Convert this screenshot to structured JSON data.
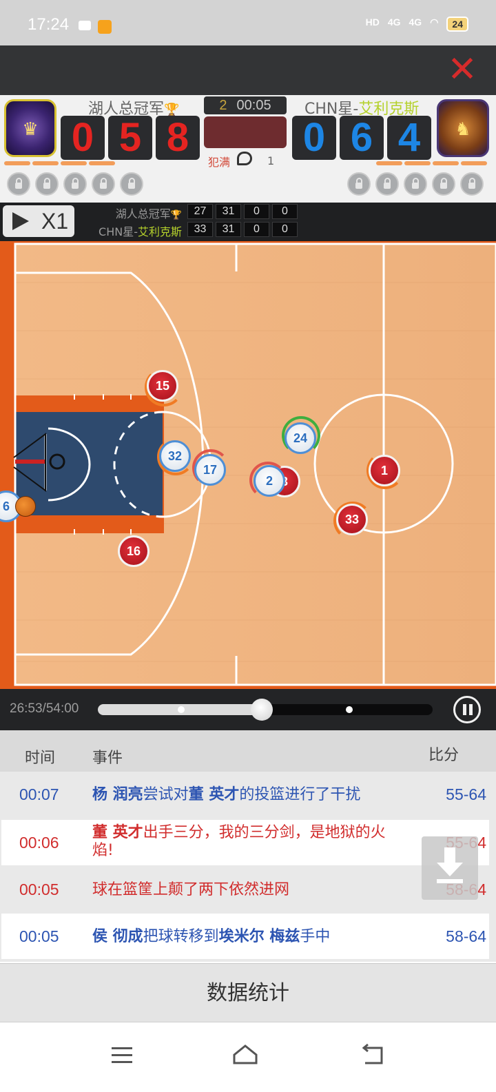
{
  "statusbar": {
    "time": "17:24",
    "hd": "HD",
    "net1": "4G",
    "net2": "4G",
    "battery": "24"
  },
  "topbar": {
    "close_icon": "close-icon"
  },
  "scoreboard": {
    "home": {
      "name": "湖人总冠军",
      "trophy": "🏆",
      "digits": [
        "0",
        "5",
        "8"
      ],
      "logo": "dragon-logo"
    },
    "away": {
      "name_prefix": "CHN星-",
      "name_highlight": "艾利克斯",
      "digits": [
        "0",
        "6",
        "4"
      ],
      "logo": "tiger-logo"
    },
    "quarter": "2",
    "game_clock": "00:05",
    "foul_label": "犯满",
    "foul_count": "1",
    "colors": {
      "home_digits": "#e52421",
      "away_digits": "#1d86e5",
      "highlight": "#b5d12c"
    }
  },
  "playback": {
    "play_icon": "play-icon",
    "speed_label": "X1",
    "quarter_scores": [
      {
        "team": "湖人总冠军",
        "trophy": "🏆",
        "scores": [
          "27",
          "31",
          "0",
          "0"
        ]
      },
      {
        "team_prefix": "CHN星-",
        "team_highlight": "艾利克斯",
        "scores": [
          "33",
          "31",
          "0",
          "0"
        ]
      }
    ]
  },
  "court": {
    "players_red": [
      "15",
      "16",
      "1",
      "33",
      "3"
    ],
    "players_blue": [
      "32",
      "17",
      "24",
      "2",
      "6"
    ]
  },
  "timeline": {
    "time_label": "26:53/54:00",
    "progress": 0.49
  },
  "events": {
    "headers": {
      "time": "时间",
      "event": "事件",
      "score": "比分"
    },
    "rows": [
      {
        "time": "00:07",
        "parts": [
          {
            "t": "杨 润亮",
            "b": true
          },
          {
            "t": "尝试对"
          },
          {
            "t": "董 英才",
            "b": true
          },
          {
            "t": "的投篮进行了干扰"
          }
        ],
        "score": "55-64",
        "color": "blue"
      },
      {
        "time": "00:06",
        "parts": [
          {
            "t": "董 英才",
            "b": true
          },
          {
            "t": "出手三分，我的三分剑，是地狱的火焰!"
          }
        ],
        "score": "55-64",
        "color": "red"
      },
      {
        "time": "00:05",
        "parts": [
          {
            "t": "球在篮筐上颠了两下依然进网"
          }
        ],
        "score": "58-64",
        "color": "red"
      },
      {
        "time": "00:05",
        "parts": [
          {
            "t": "侯 彻成",
            "b": true
          },
          {
            "t": "把球转移到"
          },
          {
            "t": "埃米尔 梅兹",
            "b": true
          },
          {
            "t": "手中"
          }
        ],
        "score": "58-64",
        "color": "blue"
      }
    ]
  },
  "stats_button": "数据统计",
  "nav": {
    "menu": "menu-icon",
    "home": "home-icon",
    "back": "back-icon"
  }
}
